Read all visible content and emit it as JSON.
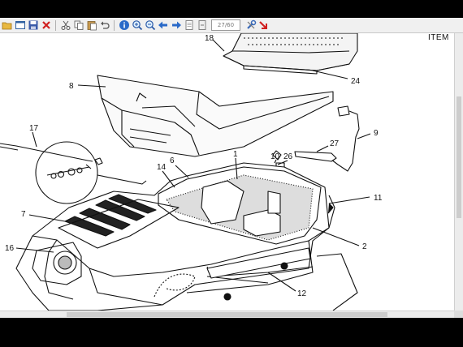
{
  "toolbar": {
    "buttons": [
      {
        "name": "open-folder-icon"
      },
      {
        "name": "view-icon"
      },
      {
        "name": "save-icon"
      },
      {
        "name": "close-red-x-icon"
      },
      {
        "name": "cut-icon"
      },
      {
        "name": "copy-icon"
      },
      {
        "name": "paste-icon"
      },
      {
        "name": "undo-icon"
      },
      {
        "name": "info-icon"
      },
      {
        "name": "zoom-in-icon"
      },
      {
        "name": "zoom-out-icon"
      },
      {
        "name": "back-arrow-icon"
      },
      {
        "name": "forward-arrow-icon"
      },
      {
        "name": "page-icon"
      },
      {
        "name": "page-alt-icon"
      }
    ],
    "page_indicator": "27/60",
    "tools_icon": "wrench-icon",
    "exit_icon": "exit-icon"
  },
  "document": {
    "header_label": "ITEM",
    "callouts": [
      "18",
      "8",
      "24",
      "17",
      "9",
      "27",
      "10",
      "26",
      "6",
      "1",
      "14",
      "11",
      "7",
      "16",
      "2",
      "12"
    ]
  }
}
